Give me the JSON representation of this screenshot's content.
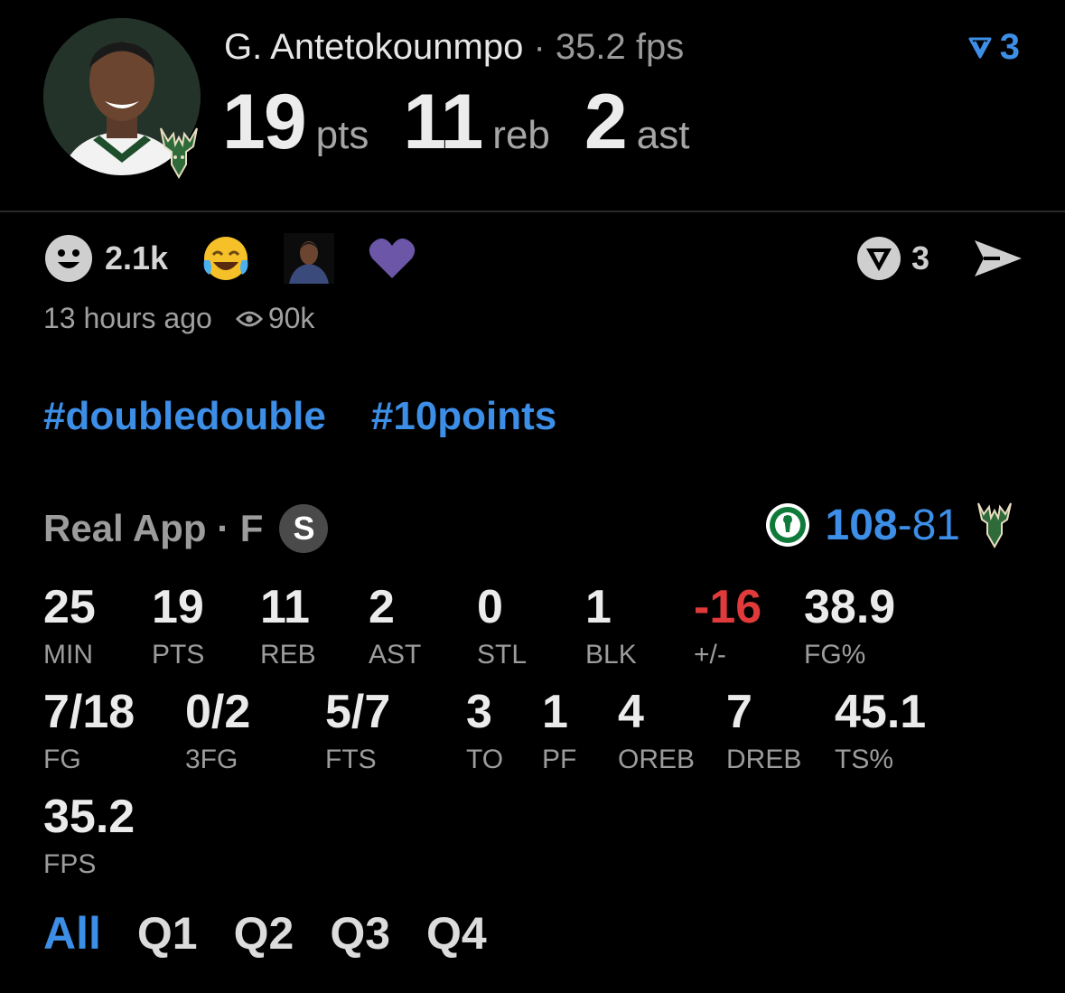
{
  "header": {
    "player_name": "G. Antetokounmpo",
    "separator": " · ",
    "fps_text": "35.2 fps",
    "stats": [
      {
        "value": "19",
        "unit": "pts"
      },
      {
        "value": "11",
        "unit": "reb"
      },
      {
        "value": "2",
        "unit": "ast"
      }
    ],
    "vote_count": "3"
  },
  "reactions": {
    "smile_count": "2.1k",
    "emojis": [
      "laughing-crying-icon",
      "player-photo-icon",
      "purple-heart-icon"
    ],
    "right_vote_count": "3"
  },
  "meta": {
    "time_ago": "13 hours ago",
    "views": "90k"
  },
  "tags": [
    "#doubledouble",
    "#10points"
  ],
  "source": {
    "label": "Real App · F",
    "badge": "S"
  },
  "score": {
    "winner": "108",
    "dash": "-",
    "loser": "81"
  },
  "stats_row1": [
    {
      "value": "25",
      "label": "MIN"
    },
    {
      "value": "19",
      "label": "PTS"
    },
    {
      "value": "11",
      "label": "REB"
    },
    {
      "value": "2",
      "label": "AST"
    },
    {
      "value": "0",
      "label": "STL"
    },
    {
      "value": "1",
      "label": "BLK"
    },
    {
      "value": "-16",
      "label": "+/-"
    },
    {
      "value": "38.9",
      "label": "FG%"
    }
  ],
  "stats_row2": [
    {
      "value": "7/18",
      "label": "FG"
    },
    {
      "value": "0/2",
      "label": "3FG"
    },
    {
      "value": "5/7",
      "label": "FTS"
    },
    {
      "value": "3",
      "label": "TO"
    },
    {
      "value": "1",
      "label": "PF"
    },
    {
      "value": "4",
      "label": "OREB"
    },
    {
      "value": "7",
      "label": "DREB"
    },
    {
      "value": "45.1",
      "label": "TS%"
    }
  ],
  "stats_row3": [
    {
      "value": "35.2",
      "label": "FPS"
    }
  ],
  "quarter_tabs": [
    "All",
    "Q1",
    "Q2",
    "Q3",
    "Q4"
  ],
  "colors": {
    "accent": "#3d8ee6",
    "negative": "#e03a3a",
    "background": "#000000"
  }
}
